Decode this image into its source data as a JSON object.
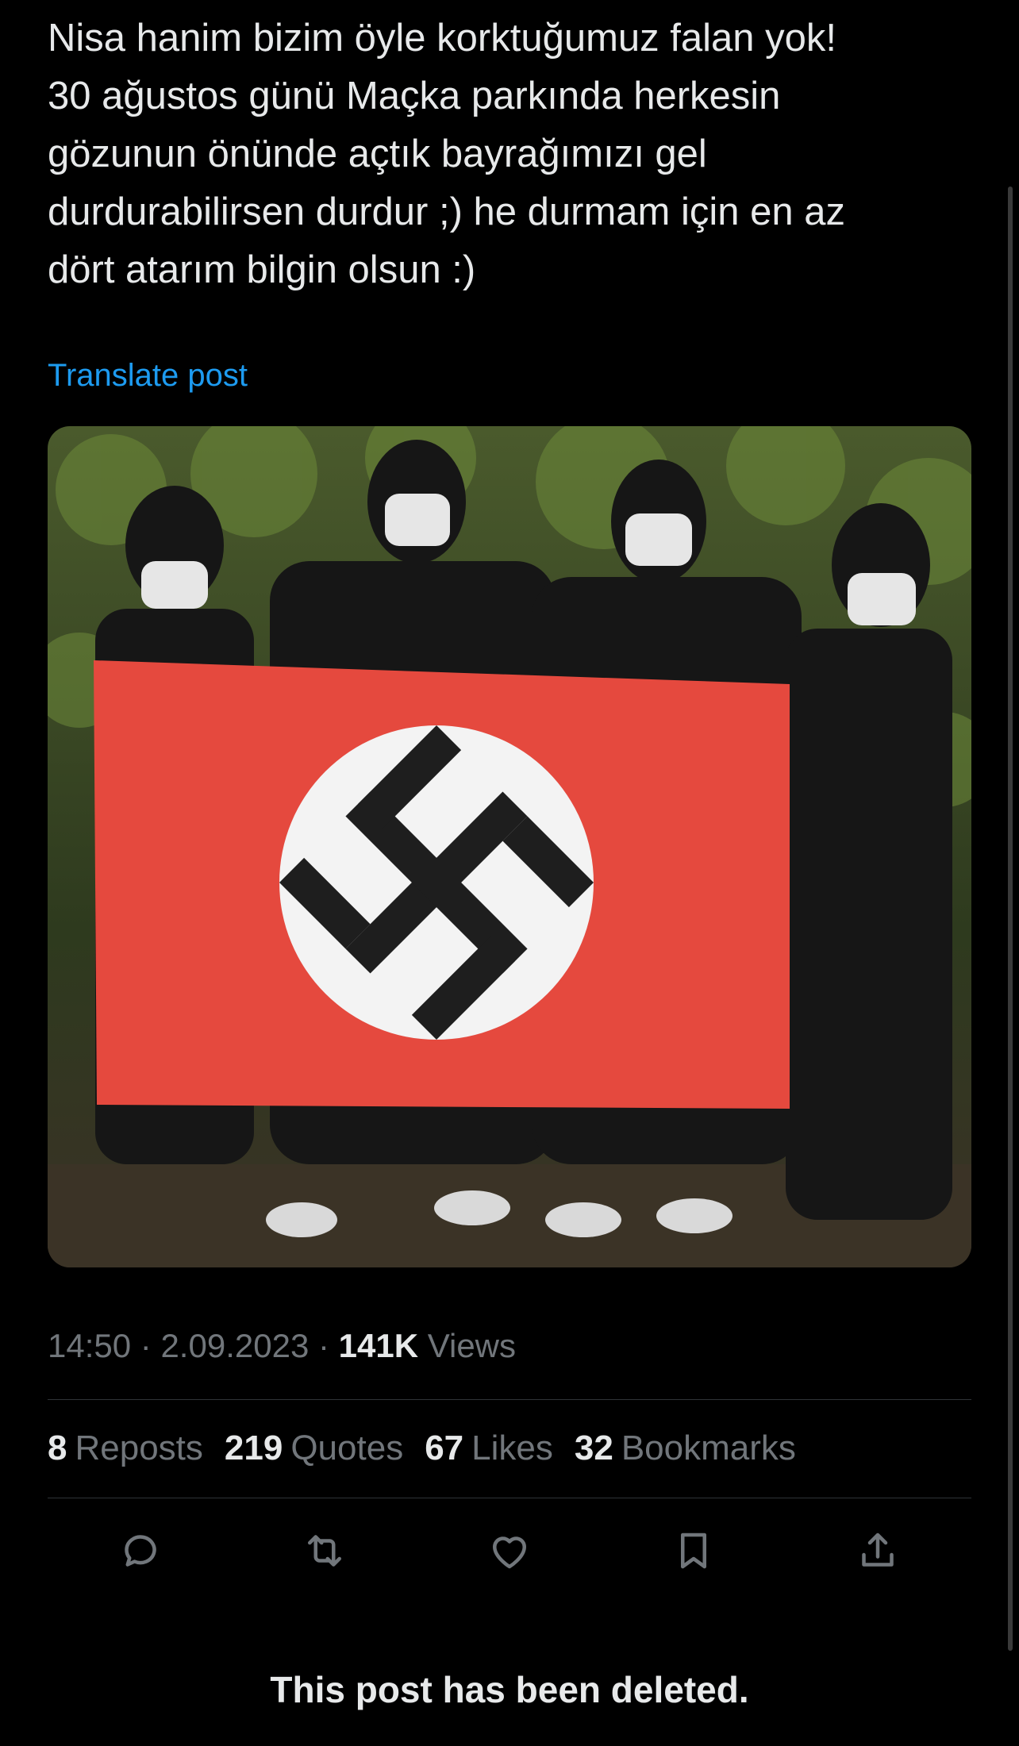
{
  "post": {
    "text": "Nisa hanim bizim öyle korktuğumuz falan yok!\n30 ağustos günü Maçka parkında herkesin\ngözunun önünde açtık bayrağımızı gel\ndurdurabilirsen durdur ;) he durmam için en az\ndört atarım bilgin olsun :)",
    "translate_label": "Translate post",
    "time": "14:50",
    "separator": "·",
    "date": "2.09.2023",
    "views_count": "141K",
    "views_label": "Views"
  },
  "stats": {
    "reposts_count": "8",
    "reposts_label": "Reposts",
    "quotes_count": "219",
    "quotes_label": "Quotes",
    "likes_count": "67",
    "likes_label": "Likes",
    "bookmarks_count": "32",
    "bookmarks_label": "Bookmarks"
  },
  "actions": {
    "icons": [
      "reply-icon",
      "repost-icon",
      "like-icon",
      "bookmark-icon",
      "share-icon"
    ]
  },
  "footer": {
    "deleted_message": "This post has been deleted."
  },
  "colors": {
    "background": "#000000",
    "text": "#e7e9ea",
    "secondary_text": "#71767b",
    "link": "#1d9bf0",
    "divider": "#2f3336"
  }
}
